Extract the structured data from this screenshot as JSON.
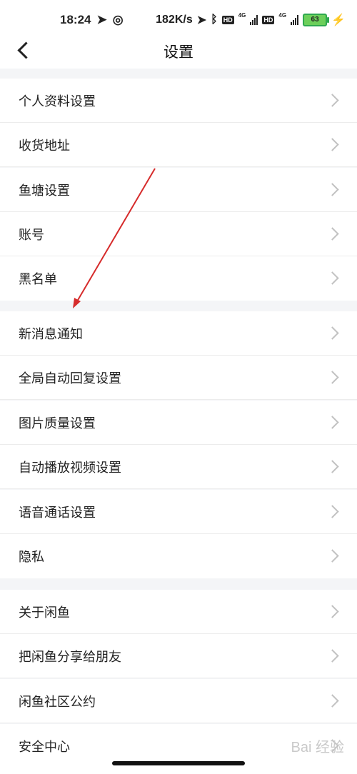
{
  "status_bar": {
    "time": "18:24",
    "speed": "182K/s",
    "battery": "63"
  },
  "header": {
    "title": "设置"
  },
  "settings": {
    "group1": [
      "个人资料设置",
      "收货地址",
      "鱼塘设置",
      "账号",
      "黑名单"
    ],
    "group2": [
      "新消息通知",
      "全局自动回复设置",
      "图片质量设置",
      "自动播放视频设置",
      "语音通话设置",
      "隐私"
    ],
    "group3": [
      "关于闲鱼",
      "把闲鱼分享给朋友",
      "闲鱼社区公约",
      "安全中心"
    ]
  },
  "annotation": {
    "arrow_color": "#d62b2b"
  },
  "watermark": "Bai 经验"
}
